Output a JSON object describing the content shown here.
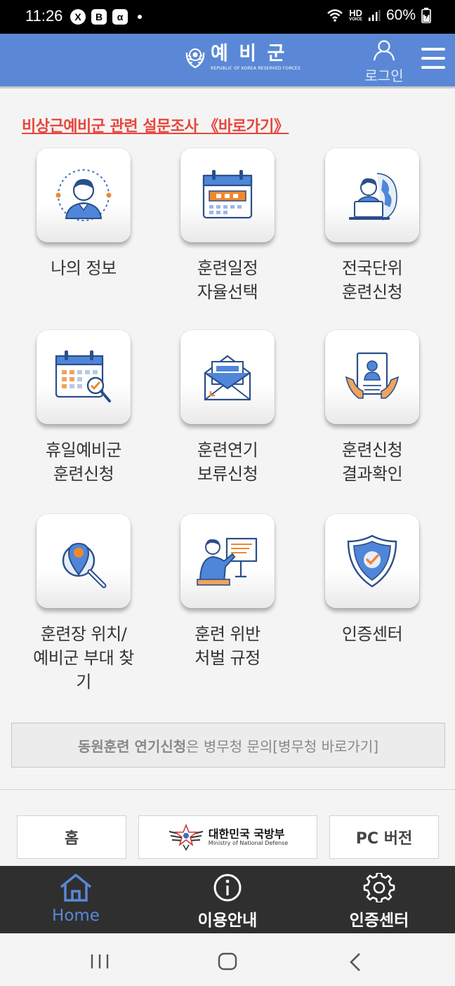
{
  "status_bar": {
    "time": "11:26",
    "app_icons": [
      "X",
      "B",
      "α"
    ],
    "network": "HD",
    "network_sub": "VOICE",
    "battery": "60%"
  },
  "header": {
    "title": "예 비 군",
    "subtitle": "REPUBLIC OF KOREA RESERVED FORCES",
    "login_label": "로그인",
    "menu_icon": "hamburger-menu-icon",
    "bg_color": "#5a88d6"
  },
  "survey_link": "비상근예비군 관련 설문조사 《바로가기》",
  "tiles": [
    {
      "icon": "person-profile-icon",
      "label": "나의 정보"
    },
    {
      "icon": "calendar-schedule-icon",
      "label": "훈련일정\n자율선택"
    },
    {
      "icon": "person-laptop-globe-icon",
      "label": "전국단위\n훈련신청"
    },
    {
      "icon": "calendar-search-icon",
      "label": "휴일예비군\n훈련신청"
    },
    {
      "icon": "envelope-letter-icon",
      "label": "훈련연기\n보류신청"
    },
    {
      "icon": "document-profile-icon",
      "label": "훈련신청\n결과확인"
    },
    {
      "icon": "location-search-icon",
      "label": "훈련장 위치/\n예비군 부대 찾\n기"
    },
    {
      "icon": "presenter-board-icon",
      "label": "훈련 위반\n처벌 규정"
    },
    {
      "icon": "shield-check-icon",
      "label": "인증센터"
    }
  ],
  "notice": {
    "bold": "동원훈련 연기신청",
    "rest": "은 병무청 문의[병무청 바로가기]"
  },
  "footer_links": {
    "home": "홈",
    "mnd_kr": "대한민국 국방부",
    "mnd_en": "Ministry of National Defense",
    "pc": "PC 버전"
  },
  "bottom_nav": [
    {
      "icon": "home-icon",
      "label": "Home",
      "active": true
    },
    {
      "icon": "info-icon",
      "label": "이용안내",
      "active": false
    },
    {
      "icon": "gear-icon",
      "label": "인증센터",
      "active": false
    }
  ],
  "colors": {
    "accent": "#5a88d6",
    "link_red": "#e8463c",
    "icon_orange": "#f0882e",
    "icon_blue": "#3d6fc0"
  }
}
